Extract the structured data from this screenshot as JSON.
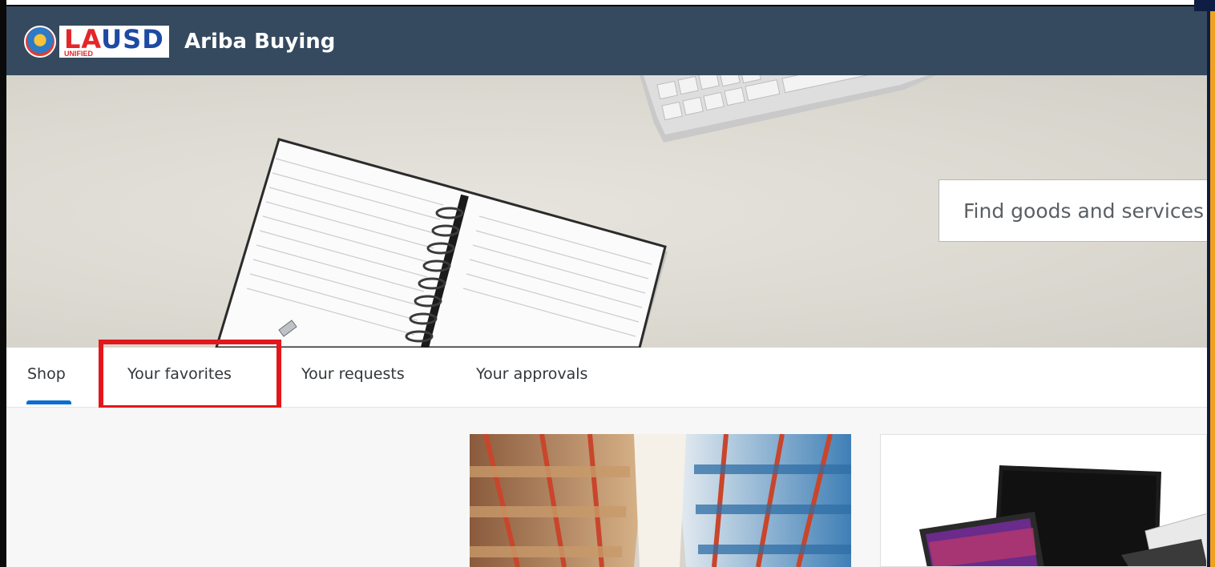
{
  "header": {
    "logo": {
      "word_red": "LA",
      "word_blue": "USD",
      "sub": "UNIFIED"
    },
    "title": "Ariba Buying",
    "bar_color": "#354a5f"
  },
  "search": {
    "placeholder": "Find goods and services"
  },
  "tabs": [
    {
      "label": "Shop",
      "active": true
    },
    {
      "label": "Your favorites",
      "active": false,
      "highlighted": true
    },
    {
      "label": "Your requests",
      "active": false
    },
    {
      "label": "Your approvals",
      "active": false
    }
  ],
  "colors": {
    "accent": "#0a6ed1",
    "highlight": "#e3171b",
    "right_stripe": "#f2a01f"
  },
  "cards": [
    {
      "image": "warehouse-shelves-image"
    },
    {
      "image": "electronics-devices-image"
    }
  ]
}
